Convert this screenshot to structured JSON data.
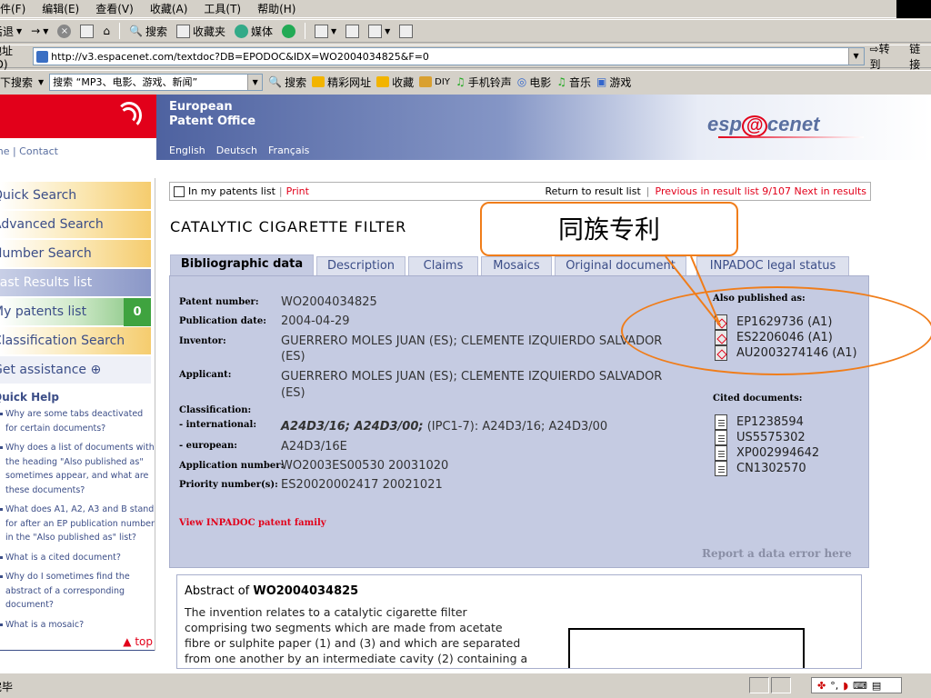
{
  "browser": {
    "menu": [
      "文件(F)",
      "编辑(E)",
      "查看(V)",
      "收藏(A)",
      "工具(T)",
      "帮助(H)"
    ],
    "toolbar": {
      "back": "后退",
      "search": "搜索",
      "favorites": "收藏夹",
      "media": "媒体"
    },
    "address_label": "地址(D)",
    "url": "http://v3.espacenet.com/textdoc?DB=EPODOC&IDX=WO2004034825&F=0",
    "go": "转到",
    "links": "链接",
    "search_bar": {
      "label": "天下搜索",
      "input": "搜索 “MP3、电影、游戏、新闻”",
      "items": [
        "搜索",
        "精彩网址",
        "收藏",
        "DIY",
        "手机铃声",
        "电影",
        "音乐",
        "游戏"
      ]
    },
    "status": "完毕"
  },
  "header": {
    "org_line1": "European",
    "org_line2": "Patent Office",
    "brand": "espacenet",
    "home_contact": "Home | Contact",
    "languages": [
      "English",
      "Deutsch",
      "Français"
    ]
  },
  "sidebar": {
    "items": [
      {
        "label": "Quick Search"
      },
      {
        "label": "Advanced Search"
      },
      {
        "label": "Number Search"
      },
      {
        "label": "Last Results list"
      },
      {
        "label": "My patents list",
        "count": "0"
      },
      {
        "label": "Classification Search"
      },
      {
        "label": "Get assistance ⊕"
      }
    ],
    "quick_help_title": "Quick Help",
    "quick_help": [
      "Why are some tabs deactivated for certain documents?",
      "Why does a list of documents with the heading \"Also published as\" sometimes appear, and what are these documents?",
      "What does A1, A2, A3 and B stand for after an EP publication number in the \"Also published as\" list?",
      "What is a cited document?",
      "Why do I sometimes find the abstract of a corresponding document?",
      "What is a mosaic?"
    ],
    "top_link": "▲ top"
  },
  "patent_bar": {
    "checkbox_label": "In my patents list",
    "print": "Print",
    "return": "Return to result list",
    "previous": "Previous",
    "position": "in result list 9/107",
    "next": "Next in results"
  },
  "title": "CATALYTIC CIGARETTE FILTER",
  "tabs": [
    "Bibliographic data",
    "Description",
    "Claims",
    "Mosaics",
    "Original document",
    "INPADOC legal status"
  ],
  "biblio": {
    "patent_number_label": "Patent number:",
    "patent_number": "WO2004034825",
    "publication_date_label": "Publication date:",
    "publication_date": "2004-04-29",
    "inventor_label": "Inventor:",
    "inventor_l1": "GUERRERO MOLES JUAN (ES); CLEMENTE IZQUIERDO SALVADOR",
    "inventor_l2": "(ES)",
    "applicant_label": "Applicant:",
    "applicant_l1": "GUERRERO MOLES JUAN (ES); CLEMENTE IZQUIERDO SALVADOR",
    "applicant_l2": "(ES)",
    "classification_label": "Classification:",
    "international_label": "- international:",
    "international_bold": "A24D3/16; A24D3/00;",
    "international_rest": "(IPC1-7): A24D3/16; A24D3/00",
    "european_label": "- european:",
    "european": "A24D3/16E",
    "application_label": "Application number:",
    "application": "WO2003ES00530 20031020",
    "priority_label": "Priority number(s):",
    "priority": "ES20020002417 20021021"
  },
  "also_published_title": "Also published as:",
  "also_published": [
    "EP1629736 (A1)",
    "ES2206046 (A1)",
    "AU2003274146 (A1)"
  ],
  "cited_title": "Cited documents:",
  "cited": [
    "EP1238594",
    "US5575302",
    "XP002994642",
    "CN1302570"
  ],
  "inpadoc_link": "View INPADOC patent family",
  "report_error": "Report a data error here",
  "abstract": {
    "heading_prefix": "Abstract of ",
    "heading_number": "WO2004034825",
    "text": "The invention relates to a catalytic cigarette filter comprising two segments which are made from acetate fibre or sulphite paper (1) and (3) and which are separated from one another by an intermediate cavity (2) containing a chemical catalyst, and to a deposit of..."
  },
  "annotation": {
    "label": "同族专利"
  },
  "colors": {
    "accent_orange": "#f07d1a",
    "epo_red": "#e2001a",
    "epo_blue": "#3b4d87",
    "panel": "#c5cbe2"
  }
}
